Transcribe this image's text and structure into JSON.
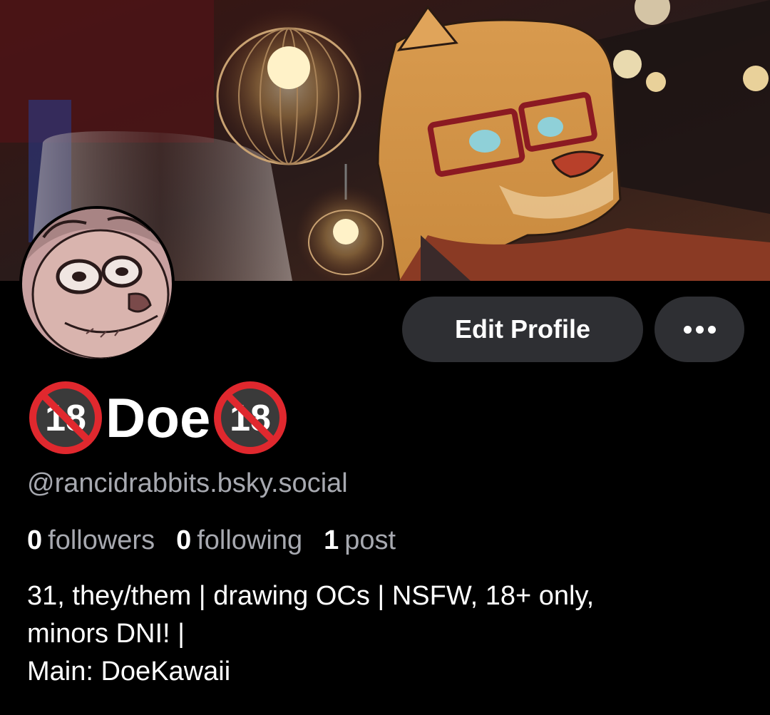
{
  "profile": {
    "name_badge_left": "🔞",
    "display_name": "Doe",
    "name_badge_right": "🔞",
    "handle": "@rancidrabbits.bsky.social",
    "stats": [
      {
        "count": "0",
        "label": "followers"
      },
      {
        "count": "0",
        "label": "following"
      },
      {
        "count": "1",
        "label": "post"
      }
    ],
    "bio_lines": [
      "31, they/them | drawing OCs | NSFW, 18+ only,",
      "minors DNI! |",
      "Main: DoeKawaii"
    ]
  },
  "actions": {
    "edit_profile_label": "Edit Profile",
    "more_icon": "ellipsis-icon"
  },
  "images": {
    "banner": "banner-image",
    "avatar": "avatar-image"
  },
  "colors": {
    "background": "#000000",
    "button_bg": "#2e2f33",
    "muted_text": "#a7a9b0",
    "badge_red": "#e0282e"
  }
}
